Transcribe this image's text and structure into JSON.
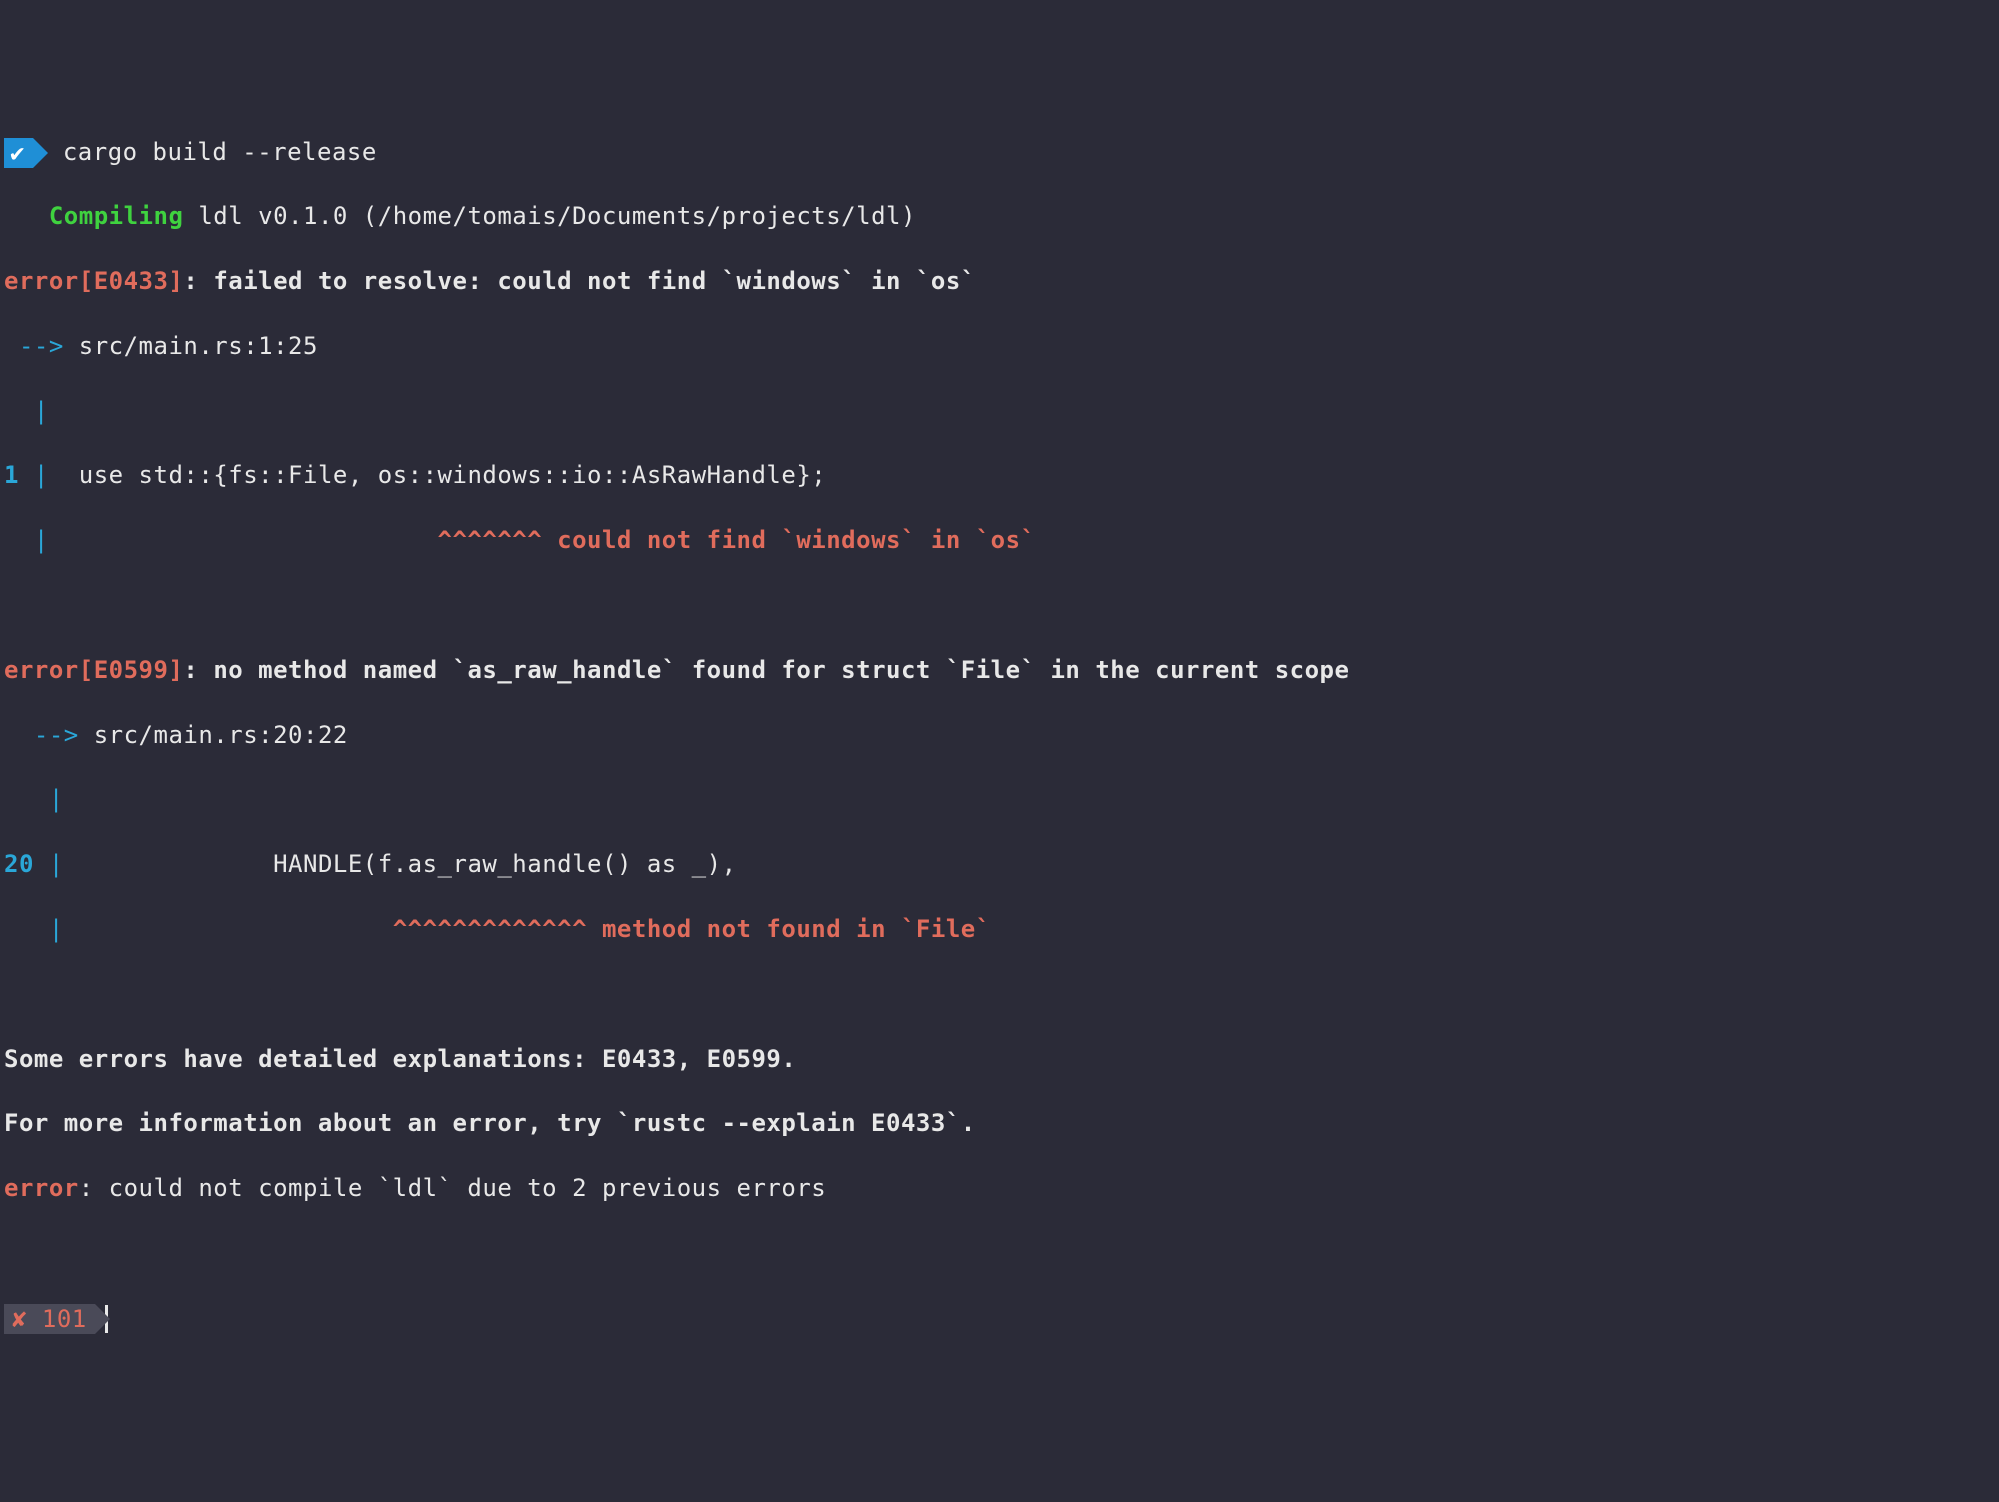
{
  "prompt_ok_glyph": "✔",
  "command": "  cargo build --release",
  "compiling_label": "Compiling",
  "compiling_rest": " ldl v0.1.0 (/home/tomais/Documents/projects/ldl)",
  "err1": {
    "tag_prefix": "error[",
    "code": "E0433",
    "tag_suffix": "]",
    "colon": ": ",
    "msg": "failed to resolve: could not find `windows` in `os`",
    "arrow": " --> ",
    "loc": "src/main.rs:1:25",
    "pipe1": "  | ",
    "ln": "1",
    "pipe2": " | ",
    "code_line": " use std::{fs::File, os::windows::io::AsRawHandle};",
    "pipe3": "  | ",
    "caret_pad": "                         ",
    "carets": "^^^^^^^",
    "note": " could not find `windows` in `os`"
  },
  "err2": {
    "tag_prefix": "error[",
    "code": "E0599",
    "tag_suffix": "]",
    "colon": ": ",
    "msg": "no method named `as_raw_handle` found for struct `File` in the current scope",
    "arrow": "  --> ",
    "loc": "src/main.rs:20:22",
    "pipe1": "   |",
    "ln": "20",
    "pipe2": " | ",
    "code_line": "             HANDLE(f.as_raw_handle() as _),",
    "pipe3": "   | ",
    "caret_pad": "                     ",
    "carets": "^^^^^^^^^^^^^",
    "note": " method not found in `File`"
  },
  "footer": {
    "some_errors": "Some errors have detailed explanations: E0433, E0599.",
    "more_info": "For more information about an error, try `rustc --explain E0433`.",
    "err_label": "error",
    "err_rest": ": could not compile `ldl` due to 2 previous errors"
  },
  "prompt_err": {
    "x": "✘",
    "code": " 101"
  }
}
